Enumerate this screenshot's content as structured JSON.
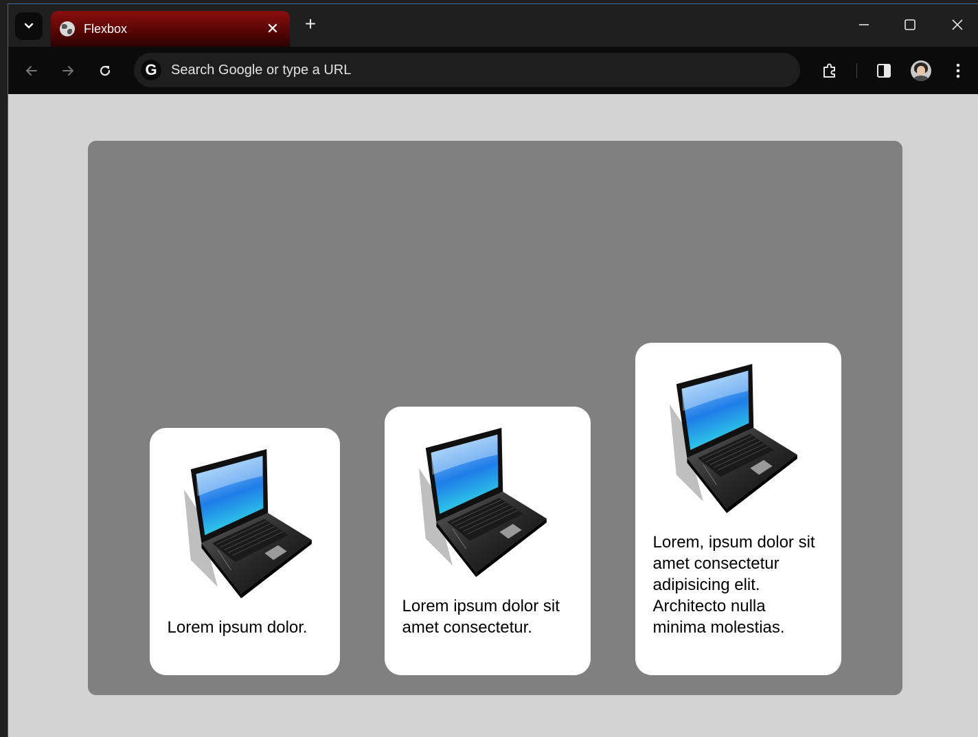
{
  "browser": {
    "tab": {
      "title": "Flexbox",
      "close_glyph": "✕"
    },
    "new_tab_glyph": "+",
    "omnibox": {
      "placeholder": "Search Google or type a URL",
      "engine_logo": "G"
    },
    "icons": [
      "tab-search-icon",
      "globe-favicon-icon",
      "close-icon",
      "plus-icon",
      "minimize-icon",
      "maximize-icon",
      "close-window-icon",
      "back-icon",
      "forward-icon",
      "reload-icon",
      "extensions-icon",
      "side-panel-icon",
      "profile-avatar",
      "more-menu-icon"
    ],
    "colors": {
      "tab_accent": "#8a0f0f",
      "page_bg": "#d3d3d3",
      "container_bg": "#808080",
      "card_bg": "#ffffff"
    }
  },
  "page": {
    "cards": [
      {
        "text": "Lorem ipsum dolor.",
        "image": "laptop-image"
      },
      {
        "text": "Lorem ipsum dolor sit amet consectetur.",
        "image": "laptop-image"
      },
      {
        "text": "Lorem, ipsum dolor sit amet consectetur adipisicing elit. Architecto nulla minima molestias.",
        "image": "laptop-image"
      }
    ]
  }
}
